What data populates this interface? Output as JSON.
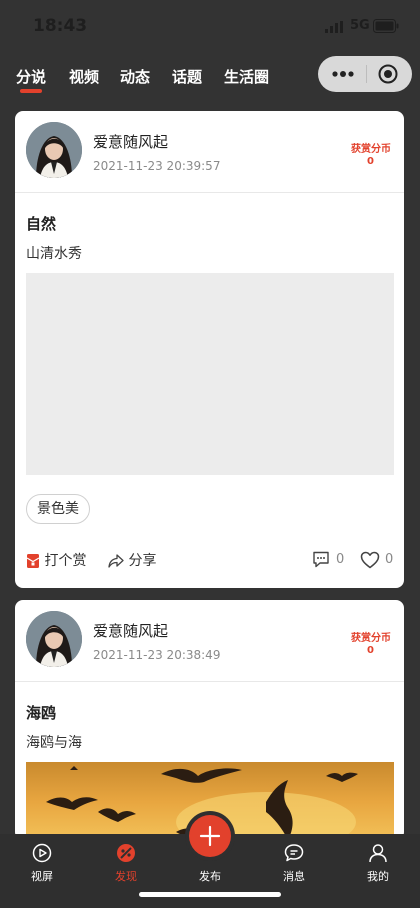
{
  "status_bar": {
    "time": "18:43",
    "network": "5G"
  },
  "tabs": [
    {
      "label": "分说",
      "active": true
    },
    {
      "label": "视频"
    },
    {
      "label": "动态"
    },
    {
      "label": "话题"
    },
    {
      "label": "生活圈"
    }
  ],
  "posts": [
    {
      "author": "爱意随风起",
      "datetime": "2021-11-23 20:39:57",
      "reward_label": "获赏分币",
      "reward_value": "0",
      "title": "自然",
      "body": "山清水秀",
      "tag": "景色美",
      "tip_label": "打个赏",
      "share_label": "分享",
      "comments": "0",
      "likes": "0"
    },
    {
      "author": "爱意随风起",
      "datetime": "2021-11-23 20:38:49",
      "reward_label": "获赏分币",
      "reward_value": "0",
      "title": "海鸥",
      "body": "海鸥与海"
    }
  ],
  "bottom_nav": [
    {
      "label": "视屏",
      "icon": "play-circle-icon"
    },
    {
      "label": "发现",
      "icon": "discover-icon",
      "active": true
    },
    {
      "label": "发布",
      "icon": "plus-icon"
    },
    {
      "label": "消息",
      "icon": "chat-bubble-icon"
    },
    {
      "label": "我的",
      "icon": "person-icon"
    }
  ],
  "colors": {
    "accent": "#e2412c",
    "background": "#333333",
    "card": "#ffffff"
  }
}
